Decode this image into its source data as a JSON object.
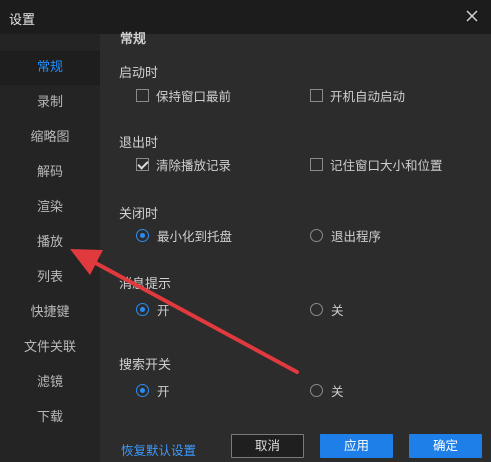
{
  "window": {
    "title": "设置"
  },
  "sidebar": {
    "items": [
      {
        "label": "常规",
        "active": true
      },
      {
        "label": "录制"
      },
      {
        "label": "缩略图"
      },
      {
        "label": "解码"
      },
      {
        "label": "渲染"
      },
      {
        "label": "播放"
      },
      {
        "label": "列表"
      },
      {
        "label": "快捷键"
      },
      {
        "label": "文件关联"
      },
      {
        "label": "滤镜"
      },
      {
        "label": "下载"
      }
    ]
  },
  "main": {
    "header": "常规",
    "startup": {
      "label": "启动时",
      "opt1": {
        "label": "保持窗口最前",
        "checked": false
      },
      "opt2": {
        "label": "开机自动启动",
        "checked": false
      }
    },
    "on_exit": {
      "label": "退出时",
      "opt1": {
        "label": "清除播放记录",
        "checked": true
      },
      "opt2": {
        "label": "记住窗口大小和位置",
        "checked": false
      }
    },
    "on_close": {
      "label": "关闭时",
      "opt1": {
        "label": "最小化到托盘",
        "selected": true
      },
      "opt2": {
        "label": "退出程序",
        "selected": false
      }
    },
    "notifications": {
      "label": "消息提示",
      "opt1": {
        "label": "开",
        "selected": true
      },
      "opt2": {
        "label": "关",
        "selected": false
      }
    },
    "search": {
      "label": "搜索开关",
      "opt1": {
        "label": "开",
        "selected": true
      },
      "opt2": {
        "label": "关",
        "selected": false
      }
    }
  },
  "footer": {
    "restore_defaults": "恢复默认设置",
    "cancel": "取消",
    "apply": "应用",
    "ok": "确定"
  },
  "colors": {
    "accent": "#1e7fe8",
    "active_nav_text": "#1e90ff",
    "annotation_arrow": "#e0393e"
  },
  "icons": {
    "close": "close-icon"
  }
}
